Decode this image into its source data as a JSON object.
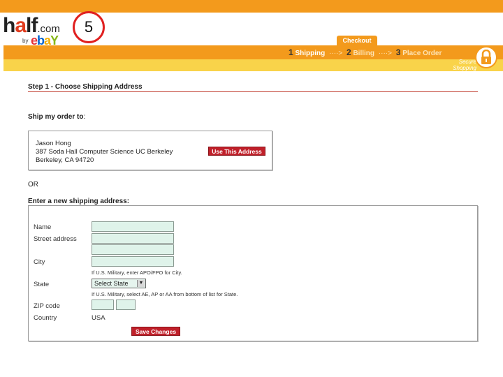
{
  "logo": {
    "brand": "half.com",
    "by": "by",
    "ebay": "ebay"
  },
  "slide_number": "5",
  "checkout_tab": "Checkout",
  "progress": {
    "steps": [
      {
        "num": "1",
        "label": "Shipping",
        "active": true
      },
      {
        "num": "2",
        "label": "Billing",
        "active": false
      },
      {
        "num": "3",
        "label": "Place Order",
        "active": false
      }
    ],
    "arrow": "····>",
    "secure_line1": "Secure",
    "secure_line2": "Shopping"
  },
  "step_title": "Step 1 - Choose Shipping Address",
  "ship_to_label": "Ship my order to",
  "ship_to_colon": ":",
  "saved_address": {
    "line1": "Jason Hong",
    "line2": "387 Soda Hall Computer Science UC Berkeley",
    "line3": "Berkeley, CA 94720",
    "button": "Use This Address"
  },
  "or_text": "OR",
  "new_address_label": "Enter a new shipping address:",
  "form": {
    "name_label": "Name",
    "street_label": "Street address",
    "city_label": "City",
    "city_note": "If U.S. Military, enter APO/FPO for City.",
    "state_label": "State",
    "state_value": "Select State",
    "state_note": "If U.S. Military, select AE, AP or AA from bottom of list for State.",
    "zip_label": "ZIP code",
    "country_label": "Country",
    "country_value": "USA",
    "save_button": "Save Changes"
  },
  "colors": {
    "orange": "#f39a1c",
    "yellow": "#f9d34a",
    "button_red": "#c0202a",
    "field_green": "#dff3ea"
  }
}
